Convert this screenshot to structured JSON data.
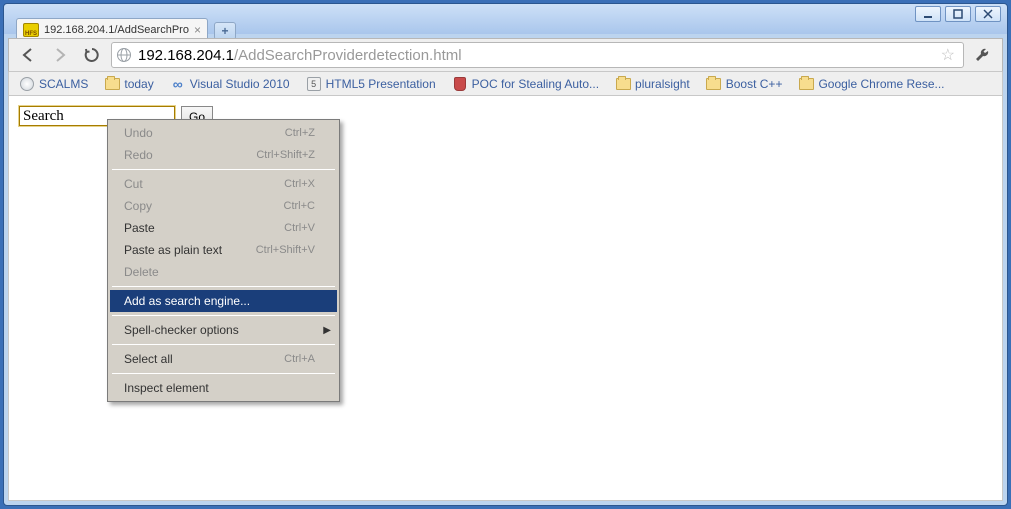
{
  "window": {
    "tab_title": "192.168.204.1/AddSearchPro",
    "url_host": "192.168.204.1",
    "url_path": "/AddSearchProviderdetection.html"
  },
  "bookmarks": [
    {
      "icon": "globe",
      "label": "SCALMS"
    },
    {
      "icon": "folder",
      "label": "today"
    },
    {
      "icon": "inf",
      "label": "Visual Studio 2010"
    },
    {
      "icon": "five",
      "label": "HTML5 Presentation"
    },
    {
      "icon": "shield",
      "label": "POC for Stealing Auto..."
    },
    {
      "icon": "folder",
      "label": "pluralsight"
    },
    {
      "icon": "folder",
      "label": "Boost C++"
    },
    {
      "icon": "folder",
      "label": "Google Chrome Rese..."
    }
  ],
  "page": {
    "search_value": "Search",
    "go_label": "Go"
  },
  "context_menu": [
    {
      "label": "Undo",
      "shortcut": "Ctrl+Z",
      "state": "disabled"
    },
    {
      "label": "Redo",
      "shortcut": "Ctrl+Shift+Z",
      "state": "disabled"
    },
    {
      "sep": true
    },
    {
      "label": "Cut",
      "shortcut": "Ctrl+X",
      "state": "disabled"
    },
    {
      "label": "Copy",
      "shortcut": "Ctrl+C",
      "state": "disabled"
    },
    {
      "label": "Paste",
      "shortcut": "Ctrl+V",
      "state": "enabled"
    },
    {
      "label": "Paste as plain text",
      "shortcut": "Ctrl+Shift+V",
      "state": "enabled"
    },
    {
      "label": "Delete",
      "shortcut": "",
      "state": "disabled"
    },
    {
      "sep": true
    },
    {
      "label": "Add as search engine...",
      "shortcut": "",
      "state": "selected"
    },
    {
      "sep": true
    },
    {
      "label": "Spell-checker options",
      "shortcut": "",
      "state": "enabled",
      "submenu": true
    },
    {
      "sep": true
    },
    {
      "label": "Select all",
      "shortcut": "Ctrl+A",
      "state": "enabled"
    },
    {
      "sep": true
    },
    {
      "label": "Inspect element",
      "shortcut": "",
      "state": "enabled"
    }
  ]
}
